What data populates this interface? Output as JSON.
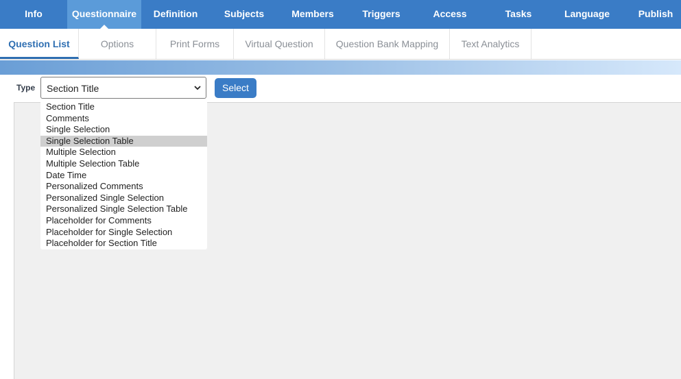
{
  "topnav": {
    "tabs": [
      "Info",
      "Questionnaire",
      "Definition",
      "Subjects",
      "Members",
      "Triggers",
      "Access",
      "Tasks",
      "Language",
      "Publish"
    ],
    "active": "Questionnaire"
  },
  "subnav": {
    "tabs": [
      "Question List",
      "Options",
      "Print Forms",
      "Virtual Question",
      "Question Bank Mapping",
      "Text Analytics"
    ],
    "active": "Question List"
  },
  "form": {
    "type_label": "Type",
    "type_value": "Section Title",
    "select_button": "Select"
  },
  "dropdown": {
    "options": [
      "Section Title",
      "Comments",
      "Single Selection",
      "Single Selection Table",
      "Multiple Selection",
      "Multiple Selection Table",
      "Date Time",
      "Personalized Comments",
      "Personalized Single Selection",
      "Personalized Single Selection Table",
      "Placeholder for Comments",
      "Placeholder for Single Selection",
      "Placeholder for Section Title"
    ],
    "highlighted": "Single Selection Table"
  },
  "colors": {
    "nav_bg": "#3a7cc6",
    "nav_active": "#5b9bd9",
    "accent": "#2f6fb2"
  }
}
